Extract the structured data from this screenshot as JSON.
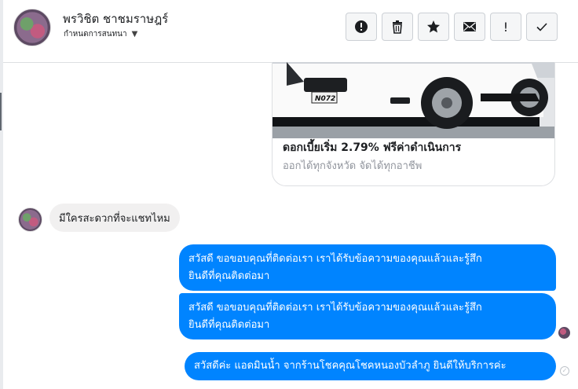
{
  "header": {
    "name": "พรวิชิต ชาชมราษฎร์",
    "subtitle": "กำหนดการสนทนา",
    "caret_icon": "caret-down-icon"
  },
  "toolbar": {
    "buttons": [
      {
        "name": "report",
        "icon": "alert-circle-icon"
      },
      {
        "name": "delete",
        "icon": "trash-icon"
      },
      {
        "name": "star",
        "icon": "star-icon"
      },
      {
        "name": "mark-unread",
        "icon": "envelope-icon"
      },
      {
        "name": "spam",
        "icon": "exclamation-icon",
        "glyph": "!"
      },
      {
        "name": "done",
        "icon": "check-icon"
      }
    ]
  },
  "ad_card": {
    "plate_text": "N072",
    "title": "ดอกเบี้ยเริ่ม 2.79% ฟรีค่าดำเนินการ",
    "subtitle": "ออกได้ทุกจังหวัด จัดได้ทุกอาชีพ"
  },
  "messages": {
    "incoming": "มีใครสะดวกที่จะแชทไหม",
    "outgoing": [
      {
        "line1": "สวัสดี ขอขอบคุณที่ติดต่อเรา เราได้รับข้อความของคุณแล้วและรู้สึก",
        "line2": "ยินดีที่คุณติดต่อมา"
      },
      {
        "line1": "สวัสดี ขอขอบคุณที่ติดต่อเรา เราได้รับข้อความของคุณแล้วและรู้สึก",
        "line2": "ยินดีที่คุณติดต่อมา"
      },
      {
        "line1": "สวัสดีค่ะ แอดมินน้ำ จากร้านโชคคุณโชคหนองบัวลำภู ยินดีให้บริการค่ะ"
      }
    ]
  },
  "colors": {
    "outgoing_bubble": "#0084ff",
    "incoming_bubble": "#f1f0f0",
    "secondary_text": "#90949c"
  }
}
